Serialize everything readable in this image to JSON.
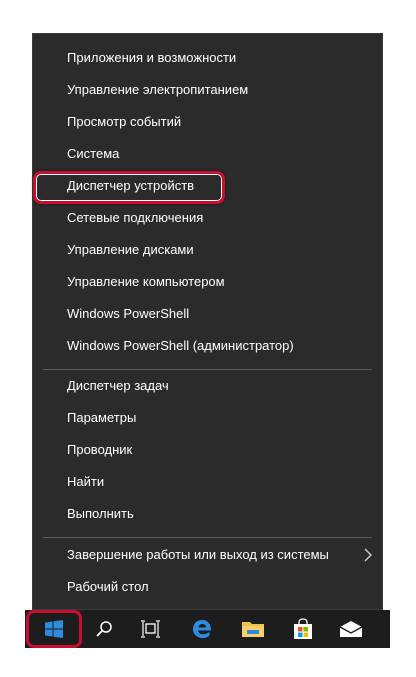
{
  "menu": {
    "items": [
      {
        "label": "Приложения и возможности"
      },
      {
        "label": "Управление электропитанием"
      },
      {
        "label": "Просмотр событий"
      },
      {
        "label": "Система"
      },
      {
        "label": "Диспетчер устройств"
      },
      {
        "label": "Сетевые подключения"
      },
      {
        "label": "Управление дисками"
      },
      {
        "label": "Управление компьютером"
      },
      {
        "label": "Windows PowerShell"
      },
      {
        "label": "Windows PowerShell (администратор)"
      },
      {
        "label": "Диспетчер задач"
      },
      {
        "label": "Параметры"
      },
      {
        "label": "Проводник"
      },
      {
        "label": "Найти"
      },
      {
        "label": "Выполнить"
      },
      {
        "label": "Завершение работы или выход из системы"
      },
      {
        "label": "Рабочий стол"
      }
    ],
    "highlighted_item": "Диспетчер устройств"
  },
  "taskbar": {
    "icons": [
      "windows-start-icon",
      "search-icon",
      "task-view-icon",
      "edge-icon",
      "file-explorer-icon",
      "store-icon",
      "mail-icon"
    ]
  },
  "colors": {
    "menu_bg": "#2b2b2b",
    "taskbar_bg": "#1d1d1d",
    "highlight": "#c8102e",
    "accent_blue": "#2d8ce0"
  }
}
